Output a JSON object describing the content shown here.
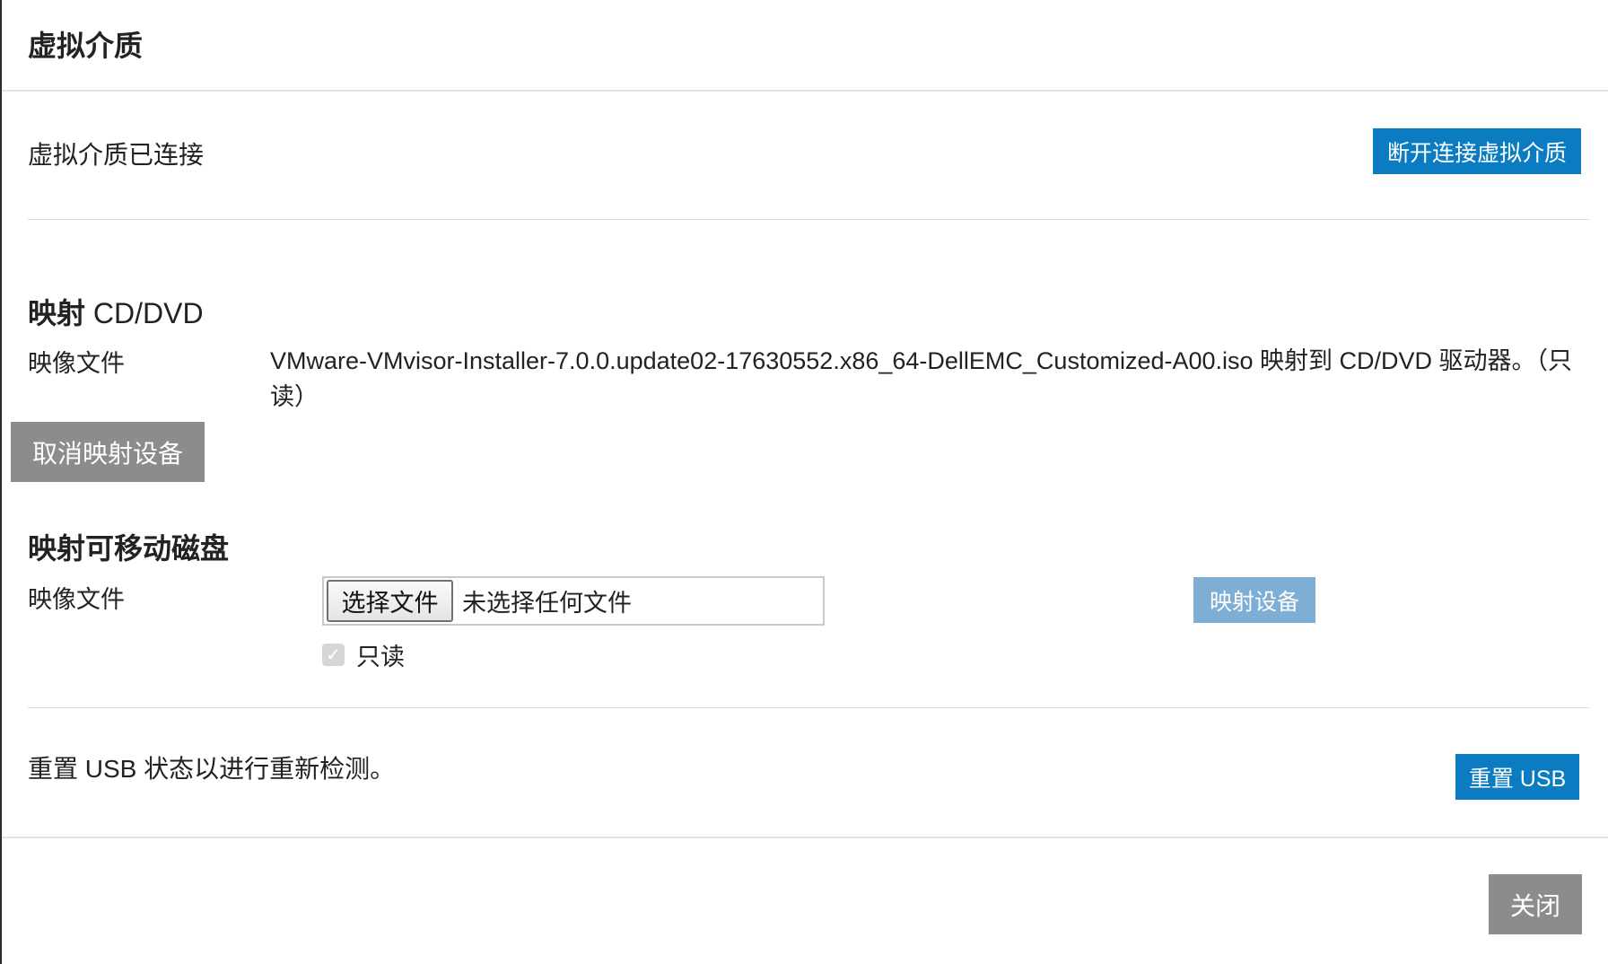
{
  "dialog": {
    "title": "虚拟介质",
    "close_label": "关闭"
  },
  "connection": {
    "status_text": "虚拟介质已连接",
    "disconnect_label": "断开连接虚拟介质"
  },
  "cd_dvd": {
    "heading_bold": "映射",
    "heading_rest": "CD/DVD",
    "image_label": "映像文件",
    "mapped_text": "VMware-VMvisor-Installer-7.0.0.update02-17630552.x86_64-DellEMC_Customized-A00.iso 映射到 CD/DVD 驱动器。（只读）",
    "unmap_label": "取消映射设备"
  },
  "removable": {
    "heading": "映射可移动磁盘",
    "image_label": "映像文件",
    "choose_file_label": "选择文件",
    "no_file_text": "未选择任何文件",
    "readonly_label": "只读",
    "readonly_checked": true,
    "map_label": "映射设备"
  },
  "usb": {
    "reset_text": "重置 USB 状态以进行重新检测。",
    "reset_label": "重置 USB"
  },
  "colors": {
    "primary": "#0b7cc1",
    "primary_disabled": "#7eaed4",
    "secondary": "#8c8c8c"
  }
}
